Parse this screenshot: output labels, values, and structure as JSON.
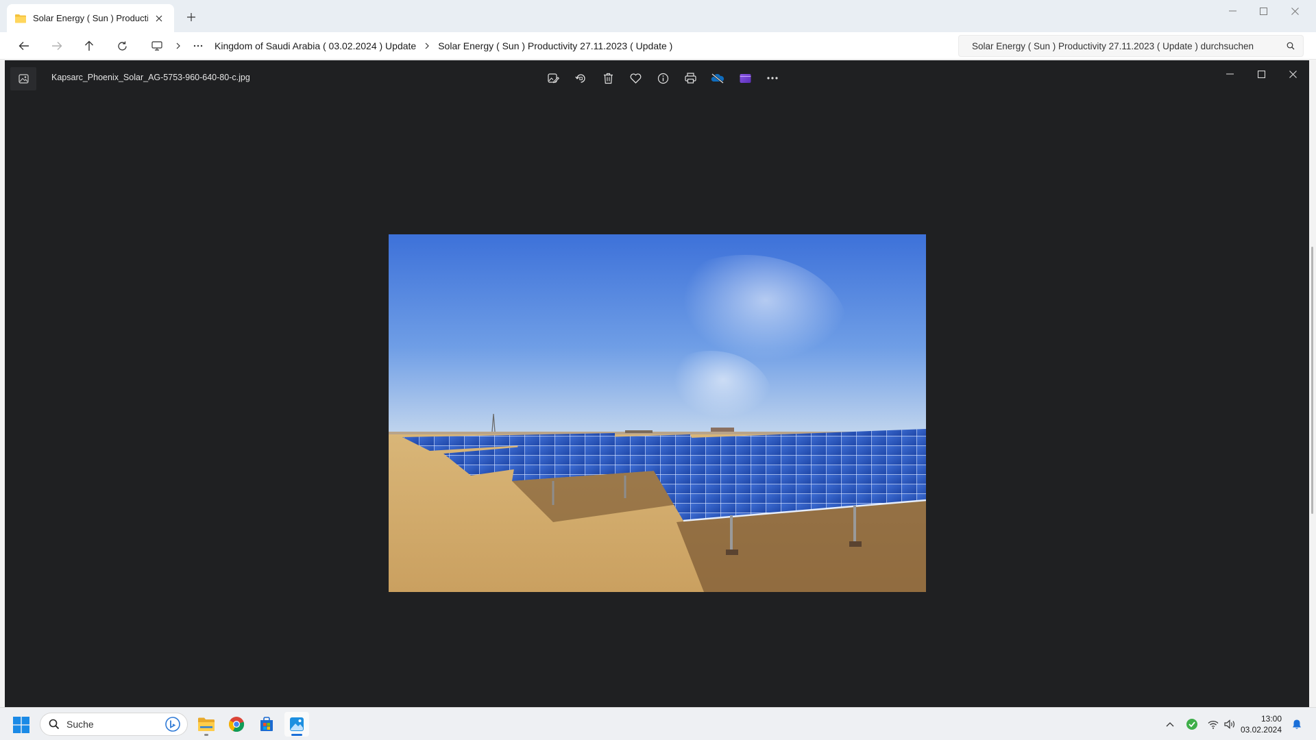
{
  "explorer": {
    "tab": {
      "label": "Solar Energy ( Sun ) Productivi",
      "icon": "folder-icon"
    },
    "breadcrumb": [
      "Kingdom of Saudi Arabia ( 03.02.2024 ) Update",
      "Solar Energy ( Sun ) Productivity 27.11.2023 ( Update )"
    ],
    "search": {
      "placeholder": "Solar Energy ( Sun ) Productivity 27.11.2023 ( Update ) durchsuchen"
    }
  },
  "viewer": {
    "file_name": "Kapsarc_Phoenix_Solar_AG-5753-960-640-80-c.jpg",
    "toolbar": [
      "edit-image-icon",
      "rotate-icon",
      "delete-icon",
      "favorite-icon",
      "info-icon",
      "print-icon",
      "onedrive-icon",
      "clipchamp-icon",
      "more-icon"
    ]
  },
  "taskbar": {
    "search_label": "Suche",
    "time": "13:00",
    "date": "03.02.2024"
  },
  "colors": {
    "viewer_bg": "#1f2022",
    "accent": "#1a6fd8"
  }
}
